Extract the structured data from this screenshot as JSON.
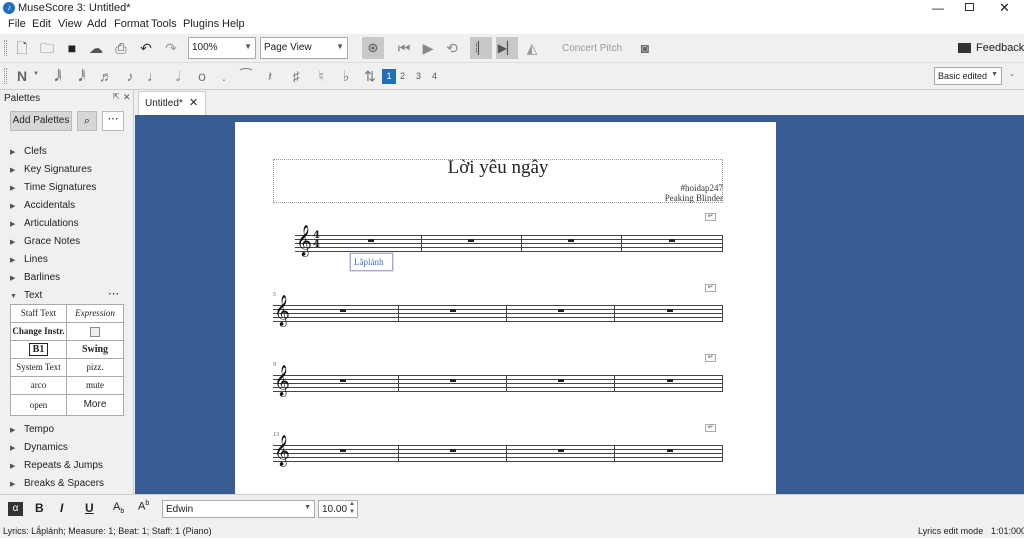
{
  "titlebar": {
    "title": "MuseScore 3: Untitled*"
  },
  "menu": [
    "File",
    "Edit",
    "View",
    "Add",
    "Format",
    "Tools",
    "Plugins",
    "Help"
  ],
  "toolbar": {
    "zoom": "100%",
    "view_mode": "Page View",
    "concert_pitch": "Concert Pitch",
    "feedback": "Feedback",
    "workspace": "Basic edited"
  },
  "voices": [
    "1",
    "2",
    "3",
    "4"
  ],
  "palettes": {
    "title": "Palettes",
    "add_button": "Add Palettes",
    "items_top": [
      "Clefs",
      "Key Signatures",
      "Time Signatures",
      "Accidentals",
      "Articulations",
      "Grace Notes",
      "Lines",
      "Barlines"
    ],
    "text_section": "Text",
    "text_grid": [
      [
        "Staff Text",
        "Expression"
      ],
      [
        "Change Instr.",
        ""
      ],
      [
        "B1",
        "Swing"
      ],
      [
        "System Text",
        "pizz."
      ],
      [
        "arco",
        "mute"
      ],
      [
        "open",
        "More"
      ]
    ],
    "items_bottom": [
      "Tempo",
      "Dynamics",
      "Repeats & Jumps",
      "Breaks & Spacers"
    ]
  },
  "tab": {
    "label": "Untitled*"
  },
  "score": {
    "title": "Lời yêu ngây",
    "subtitle": "#hoidap247",
    "composer": "Peaking Blinder",
    "lyric": "Lắplánh",
    "measure_numbers": [
      "5",
      "9",
      "13"
    ],
    "time_sig_top": "4",
    "time_sig_bottom": "4"
  },
  "textbar": {
    "font": "Edwin",
    "size": "10.00"
  },
  "status": {
    "left": "Lyrics: Lắplánh;  Measure: 1; Beat: 1; Staff: 1 (Piano)",
    "mode": "Lyrics edit mode",
    "time": "1:01:000"
  }
}
